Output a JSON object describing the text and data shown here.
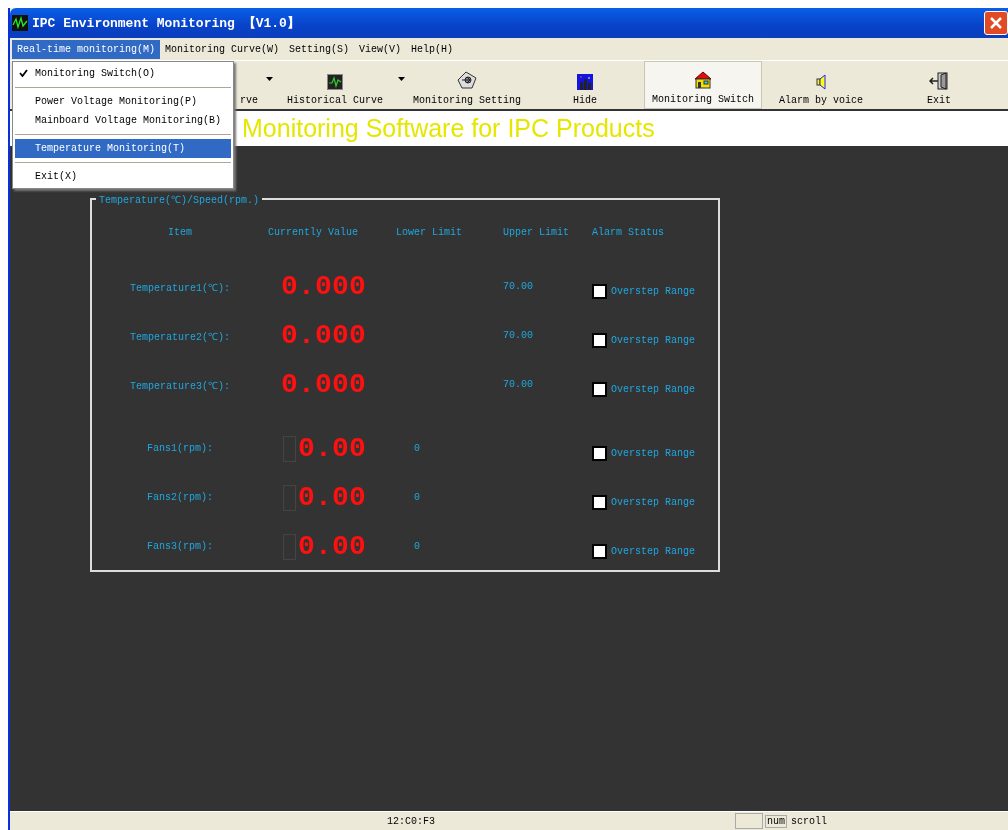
{
  "window": {
    "title": "IPC Environment Monitoring 【V1.0】"
  },
  "menubar": [
    {
      "label": "Real-time monitoring(M)",
      "selected": true
    },
    {
      "label": "Monitoring Curve(W)",
      "selected": false
    },
    {
      "label": "Setting(S)",
      "selected": false
    },
    {
      "label": "View(V)",
      "selected": false
    },
    {
      "label": "Help(H)",
      "selected": false
    }
  ],
  "menu": [
    {
      "kind": "item",
      "label": "Monitoring Switch(O)",
      "checked": true,
      "selected": false
    },
    {
      "kind": "separator"
    },
    {
      "kind": "item",
      "label": "Power Voltage Monitoring(P)",
      "checked": false,
      "selected": false
    },
    {
      "kind": "item",
      "label": "Mainboard Voltage Monitoring(B)",
      "checked": false,
      "selected": false
    },
    {
      "kind": "separator"
    },
    {
      "kind": "item",
      "label": "Temperature Monitoring(T)",
      "checked": false,
      "selected": true
    },
    {
      "kind": "separator"
    },
    {
      "kind": "item",
      "label": "Exit(X)",
      "checked": false,
      "selected": false
    }
  ],
  "toolbar": [
    {
      "label": "rve",
      "dropdown": true,
      "selected": false
    },
    {
      "label": "Historical Curve",
      "dropdown": true,
      "selected": false
    },
    {
      "label": "Monitoring Setting",
      "dropdown": false,
      "selected": false
    },
    {
      "label": "Hide",
      "dropdown": false,
      "selected": false
    },
    {
      "label": "Monitoring Switch",
      "dropdown": false,
      "selected": true
    },
    {
      "label": "Alarm by voice",
      "dropdown": false,
      "selected": false
    },
    {
      "label": "Exit",
      "dropdown": false,
      "selected": false
    }
  ],
  "banner": "Monitoring Software for IPC Products",
  "panel": {
    "legend": "Temperature(℃)/Speed(rpm.)",
    "columns": [
      "Item",
      "Currently Value",
      "Lower Limit",
      "Upper Limit",
      "Alarm Status"
    ],
    "groups": [
      [
        {
          "item": "Temperature1(℃):",
          "display": "0.000",
          "upper": "70.00",
          "alarm": "Overstep Range",
          "checked": false
        },
        {
          "item": "Temperature2(℃):",
          "display": "0.000",
          "upper": "70.00",
          "alarm": "Overstep Range",
          "checked": false
        },
        {
          "item": "Temperature3(℃):",
          "display": "0.000",
          "upper": "70.00",
          "alarm": "Overstep Range",
          "checked": false
        }
      ],
      [
        {
          "item": "Fans1(rpm):",
          "display": "0.00",
          "lower": "0",
          "alarm": "Overstep Range",
          "checked": false
        },
        {
          "item": "Fans2(rpm):",
          "display": "0.00",
          "lower": "0",
          "alarm": "Overstep Range",
          "checked": false
        },
        {
          "item": "Fans3(rpm):",
          "display": "0.00",
          "lower": "0",
          "alarm": "Overstep Range",
          "checked": false
        }
      ]
    ]
  },
  "status_bar": [
    "12:C0:F3",
    "num",
    "scroll"
  ]
}
